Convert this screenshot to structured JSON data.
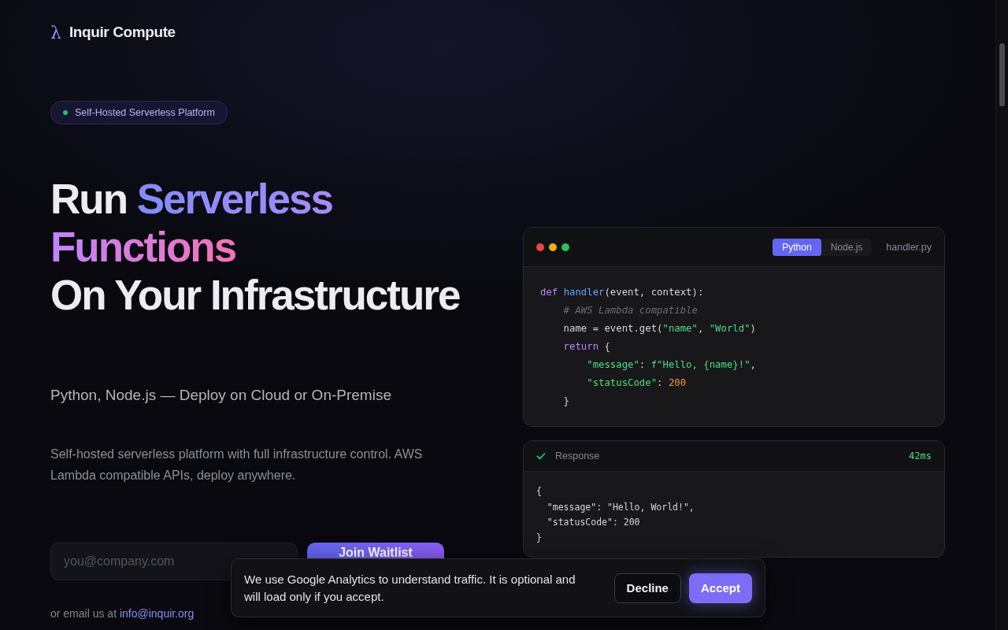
{
  "brand": {
    "logo": "λ",
    "name": "Inquir Compute"
  },
  "badge": {
    "label": "Self-Hosted Serverless Platform"
  },
  "headline": [
    [
      {
        "text": "Run ",
        "kind": "plain"
      },
      {
        "text": "Serverless",
        "kind": "gradient"
      }
    ],
    [
      {
        "text": "Functions",
        "kind": "gradient2"
      }
    ],
    [
      {
        "text": "On Your Infrastructure",
        "kind": "plain"
      }
    ]
  ],
  "subtitle": "Python, Node.js — Deploy on Cloud or On-Premise",
  "description": "Self-hosted serverless platform with full infrastructure control. AWS Lambda compatible APIs, deploy anywhere.",
  "signup": {
    "placeholder": "you@company.com",
    "button": "Join Waitlist",
    "contact_prefix": "or email us at ",
    "contact_link": "info@inquir.org"
  },
  "code_window": {
    "tabs": [
      {
        "label": "Python",
        "selected": true
      },
      {
        "label": "Node.js",
        "selected": false
      }
    ],
    "filename": "handler.py",
    "lines": [
      [
        {
          "kind": "keyword",
          "text": "def "
        },
        {
          "kind": "function",
          "text": "handler"
        },
        {
          "kind": "plain",
          "text": "(event, context):"
        }
      ],
      [
        {
          "kind": "comment",
          "text": "    # AWS Lambda compatible"
        }
      ],
      [
        {
          "kind": "plain",
          "text": "    name = event.get("
        },
        {
          "kind": "string",
          "text": "\"name\""
        },
        {
          "kind": "plain",
          "text": ", "
        },
        {
          "kind": "string",
          "text": "\"World\""
        },
        {
          "kind": "plain",
          "text": ")"
        }
      ],
      [
        {
          "kind": "keyword",
          "text": "    return "
        },
        {
          "kind": "plain",
          "text": "{"
        }
      ],
      [
        {
          "kind": "string",
          "text": "        \"message\""
        },
        {
          "kind": "plain",
          "text": ": "
        },
        {
          "kind": "string",
          "text": "f\"Hello, {name}!\""
        },
        {
          "kind": "plain",
          "text": ","
        }
      ],
      [
        {
          "kind": "string",
          "text": "        \"statusCode\""
        },
        {
          "kind": "plain",
          "text": ": "
        },
        {
          "kind": "number",
          "text": "200"
        }
      ],
      [
        {
          "kind": "plain",
          "text": "    }"
        }
      ]
    ]
  },
  "response": {
    "success": true,
    "label": "Response",
    "time": "42ms",
    "lines": [
      "{",
      "  \"message\": \"Hello, World!\",",
      "  \"statusCode\": 200",
      "}"
    ]
  },
  "cookie_banner": {
    "message": "We use Google Analytics to understand traffic. It is optional and will load only if you accept.",
    "buttons": [
      {
        "label": "Decline",
        "kind": "secondary"
      },
      {
        "label": "Accept",
        "kind": "primary"
      }
    ]
  }
}
